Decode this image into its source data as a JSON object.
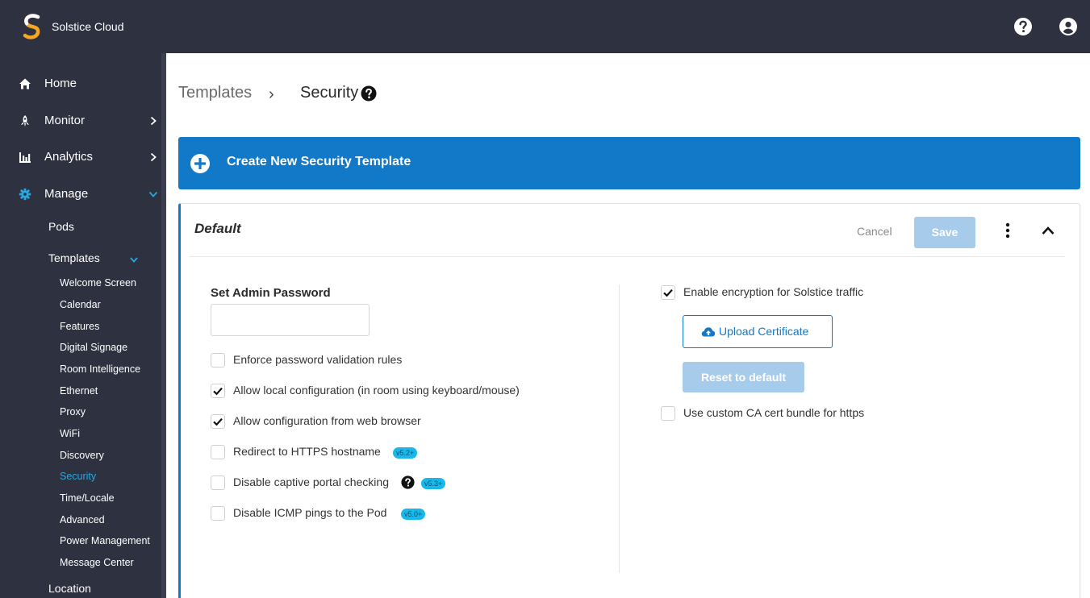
{
  "app": {
    "title": "Solstice Cloud",
    "logo_icon": "solstice-logo",
    "help_icon": "question-circle-icon",
    "user_icon": "user-circle-icon"
  },
  "colors": {
    "topbar": "#2e3140",
    "accent": "#1179c8",
    "active_nav": "#29a8e0",
    "badge": "#19b8ea",
    "disabled_button": "#a6cbeb"
  },
  "sidebar": {
    "main": [
      {
        "label": "Home",
        "icon": "home-icon",
        "expandable": false
      },
      {
        "label": "Monitor",
        "icon": "rocket-icon",
        "expandable": true,
        "expanded": false
      },
      {
        "label": "Analytics",
        "icon": "bar-chart-icon",
        "expandable": true,
        "expanded": false
      },
      {
        "label": "Manage",
        "icon": "gear-icon",
        "expandable": true,
        "expanded": true
      }
    ],
    "manage_sub": [
      {
        "label": "Pods"
      },
      {
        "label": "Templates",
        "expanded": true
      }
    ],
    "templates": [
      "Welcome Screen",
      "Calendar",
      "Features",
      "Digital Signage",
      "Room Intelligence",
      "Ethernet",
      "Proxy",
      "WiFi",
      "Discovery",
      "Security",
      "Time/Locale",
      "Advanced",
      "Power Management",
      "Message Center"
    ],
    "active_template": "Security",
    "bottom_item": "Location"
  },
  "breadcrumb": {
    "parent": "Templates",
    "separator": "›",
    "current": "Security"
  },
  "create_button": {
    "label": "Create New Security Template",
    "icon": "plus-circle-icon"
  },
  "card": {
    "title": "Default",
    "cancel_label": "Cancel",
    "save_label": "Save",
    "menu_icon": "kebab-menu-icon",
    "collapse_icon": "chevron-up-icon",
    "left": {
      "password_label": "Set Admin Password",
      "password_value": "",
      "options": [
        {
          "label": "Enforce password validation rules",
          "checked": false
        },
        {
          "label": "Allow local configuration (in room using keyboard/mouse)",
          "checked": true
        },
        {
          "label": "Allow configuration from web browser",
          "checked": true
        },
        {
          "label": "Redirect to HTTPS hostname",
          "checked": false,
          "badge": "v5.2+"
        },
        {
          "label": "Disable captive portal checking",
          "checked": false,
          "badge": "v5.3+",
          "help": true
        },
        {
          "label": "Disable ICMP pings to the Pod",
          "checked": false,
          "badge": "v5.0+"
        }
      ]
    },
    "right": {
      "encryption": {
        "label": "Enable encryption for Solstice traffic",
        "checked": true
      },
      "upload_label": "Upload Certificate",
      "upload_icon": "cloud-upload-icon",
      "reset_label": "Reset to default",
      "custom_ca": {
        "label": "Use custom CA cert bundle for https",
        "checked": false
      }
    }
  }
}
